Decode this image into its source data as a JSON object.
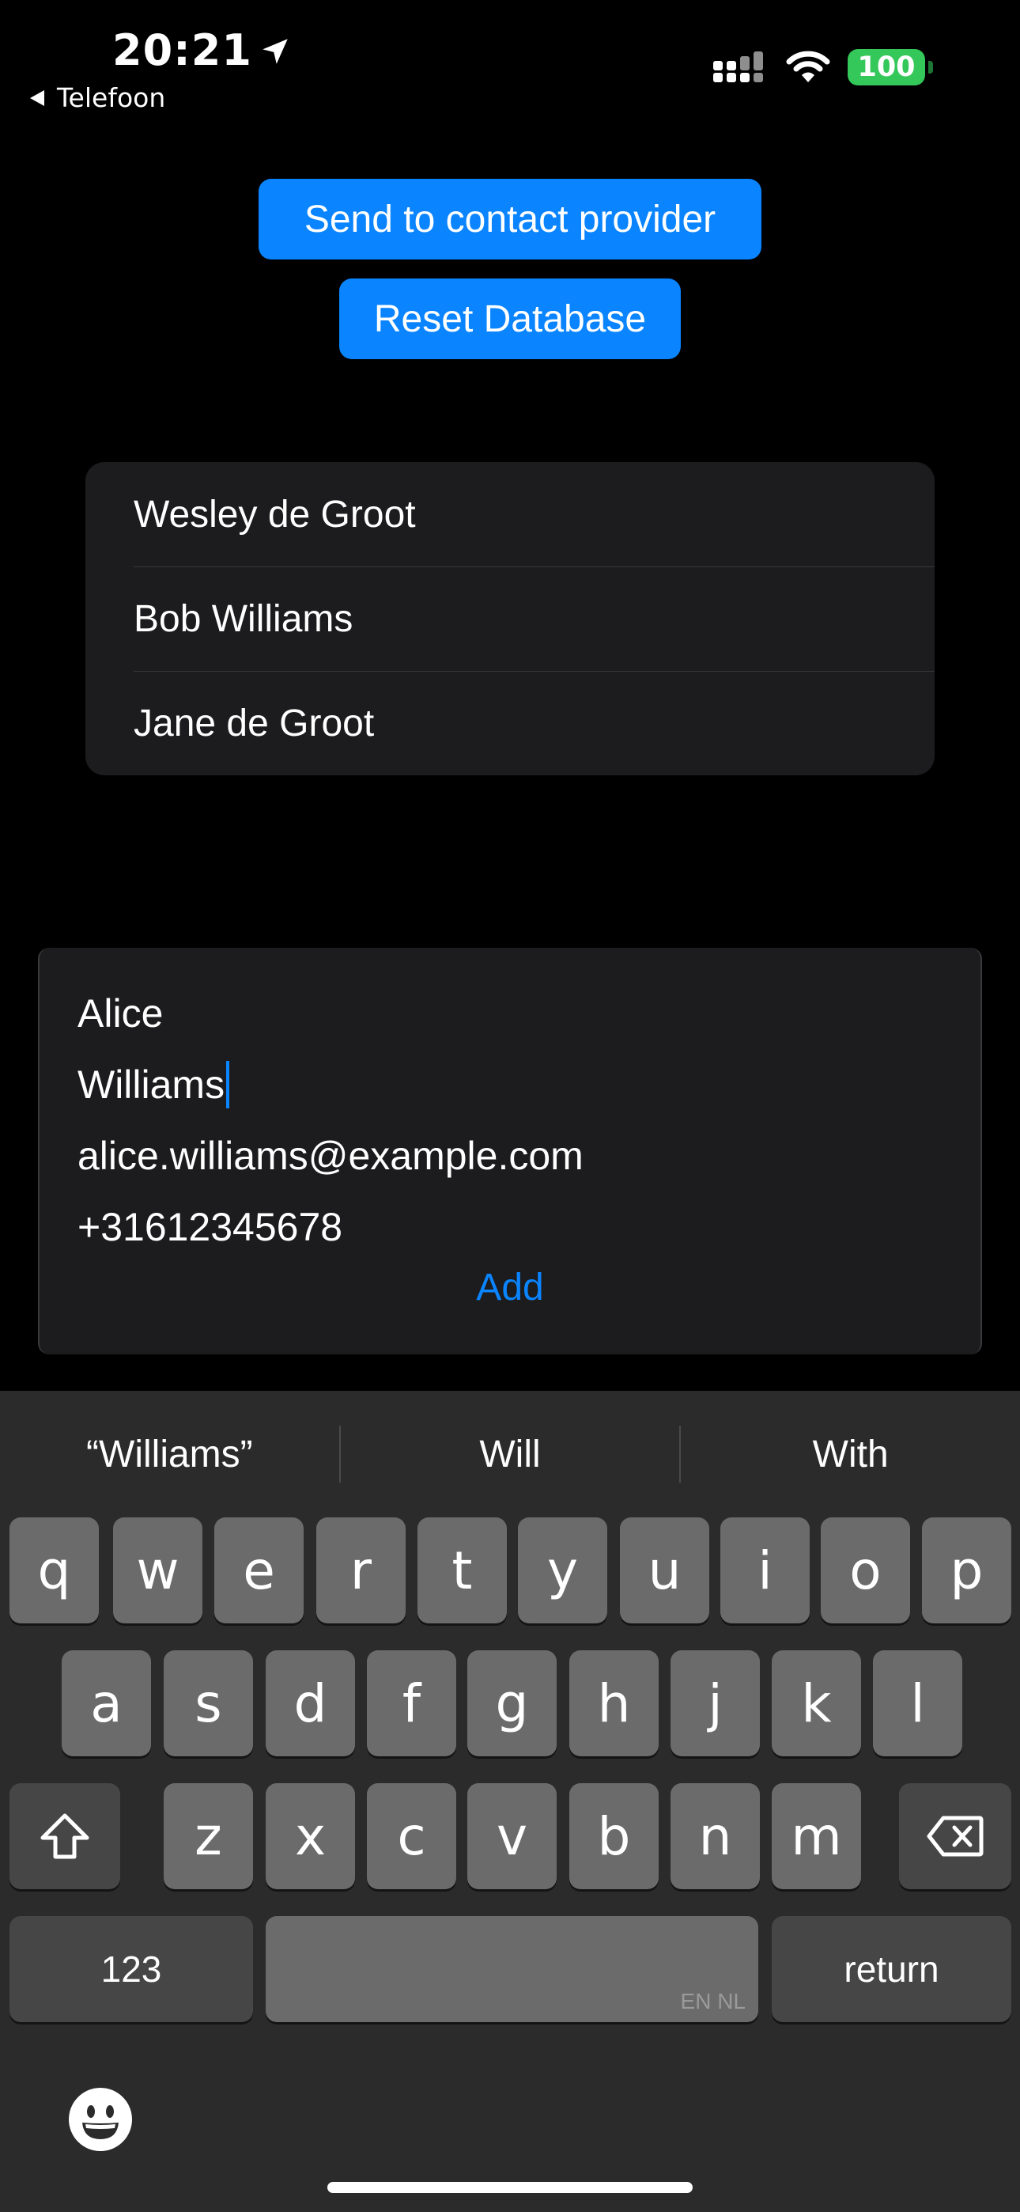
{
  "status_bar": {
    "time": "20:21",
    "back_label": "Telefoon",
    "battery": "100",
    "battery_color": "#34c759",
    "icons": [
      "location-arrow-icon",
      "cellular-signal-icon",
      "wifi-icon",
      "battery-icon"
    ]
  },
  "actions": {
    "send_label": "Send to contact provider",
    "reset_label": "Reset Database",
    "accent": "#0a84ff"
  },
  "contacts": [
    {
      "name": "Wesley de Groot"
    },
    {
      "name": "Bob Williams"
    },
    {
      "name": "Jane de Groot"
    }
  ],
  "form": {
    "first_name": "Alice",
    "last_name": "Williams",
    "email": "alice.williams@example.com",
    "phone": "+31612345678",
    "add_label": "Add"
  },
  "keyboard": {
    "suggestions": [
      "“Williams”",
      "Will",
      "With"
    ],
    "row1": [
      "q",
      "w",
      "e",
      "r",
      "t",
      "y",
      "u",
      "i",
      "o",
      "p"
    ],
    "row2": [
      "a",
      "s",
      "d",
      "f",
      "g",
      "h",
      "j",
      "k",
      "l"
    ],
    "row3": [
      "z",
      "x",
      "c",
      "v",
      "b",
      "n",
      "m"
    ],
    "numbers_label": "123",
    "space_languages": "EN NL",
    "return_label": "return",
    "icons": [
      "shift-icon",
      "backspace-icon",
      "emoji-icon"
    ]
  }
}
